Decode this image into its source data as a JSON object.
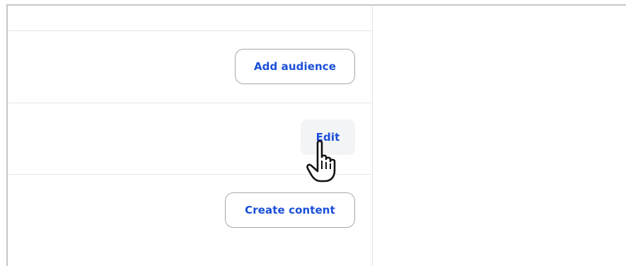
{
  "rows": [
    {
      "action_label": "Add audience"
    },
    {
      "action_label": "Edit"
    },
    {
      "action_label": "Create content"
    }
  ],
  "cursor": {
    "type": "hand-pointer-icon"
  }
}
